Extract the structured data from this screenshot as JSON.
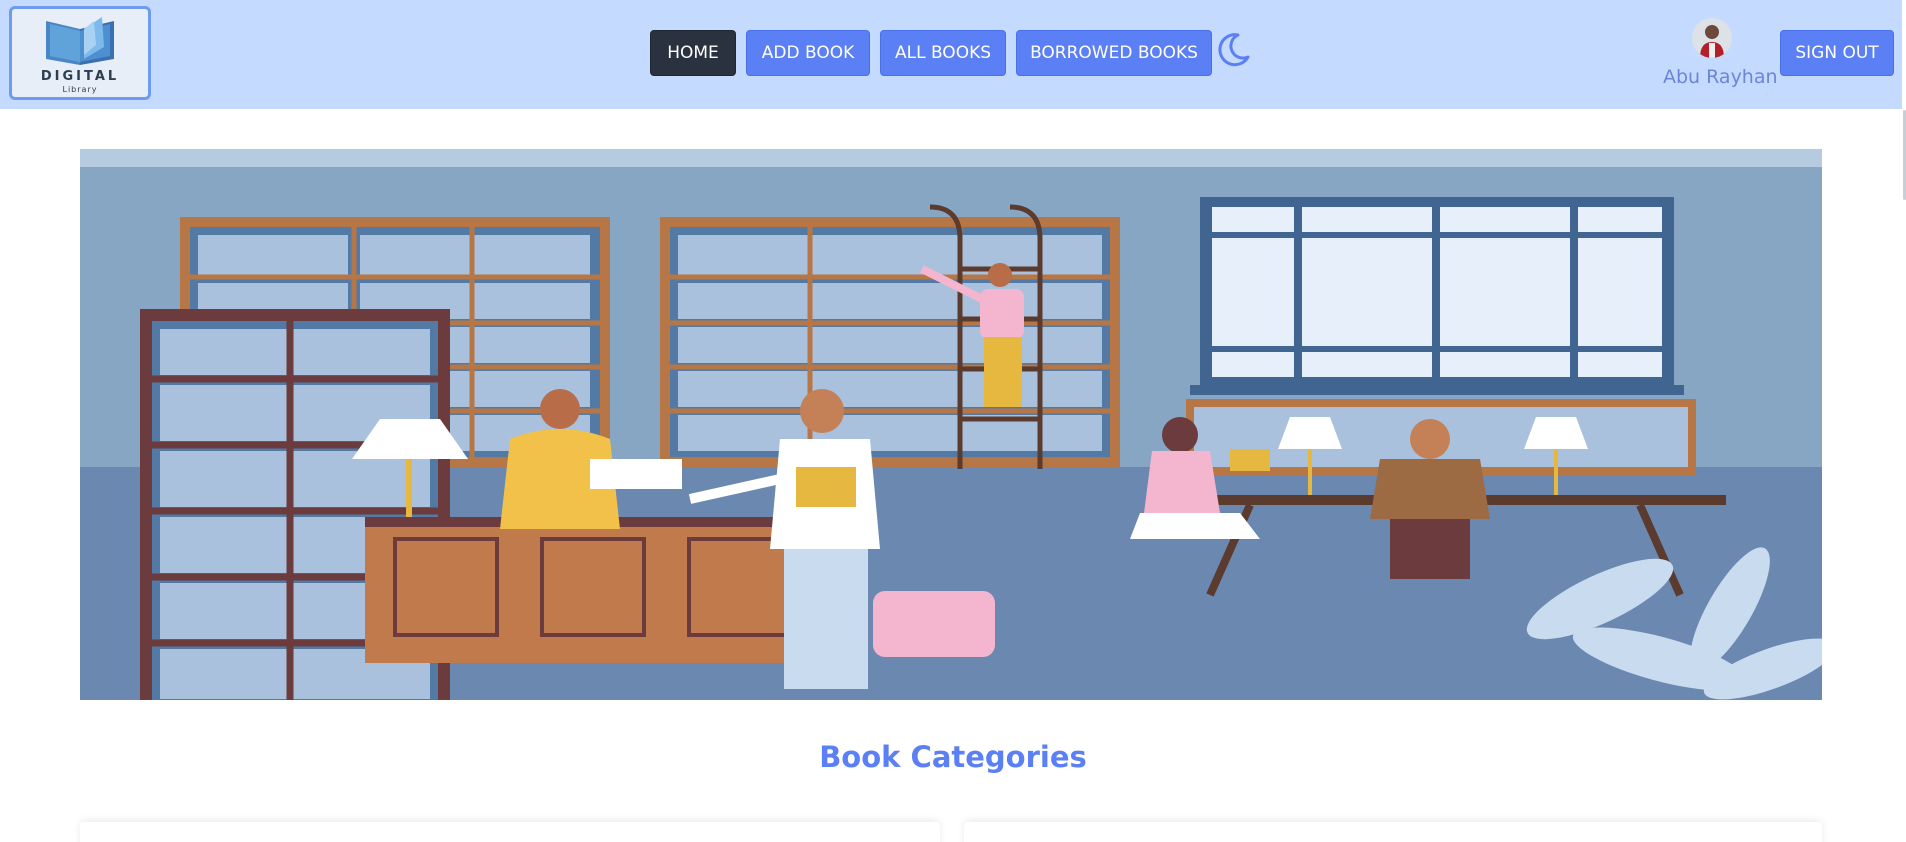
{
  "brand": {
    "logo_title": "DIGITAL",
    "logo_subtitle": "Library"
  },
  "nav": {
    "items": [
      {
        "label": "HOME",
        "active": true
      },
      {
        "label": "ADD BOOK",
        "active": false
      },
      {
        "label": "ALL BOOKS",
        "active": false
      },
      {
        "label": "BORROWED BOOKS",
        "active": false
      }
    ],
    "theme_toggle_icon": "moon-icon"
  },
  "user": {
    "name": "Abu Rayhan",
    "signout_label": "SIGN OUT"
  },
  "main": {
    "section_title": "Book Categories"
  },
  "colors": {
    "navbar_bg": "#c4daff",
    "accent": "#5b7ff4",
    "active_nav": "#2a323f",
    "hero_bg": "#86a6c4"
  }
}
